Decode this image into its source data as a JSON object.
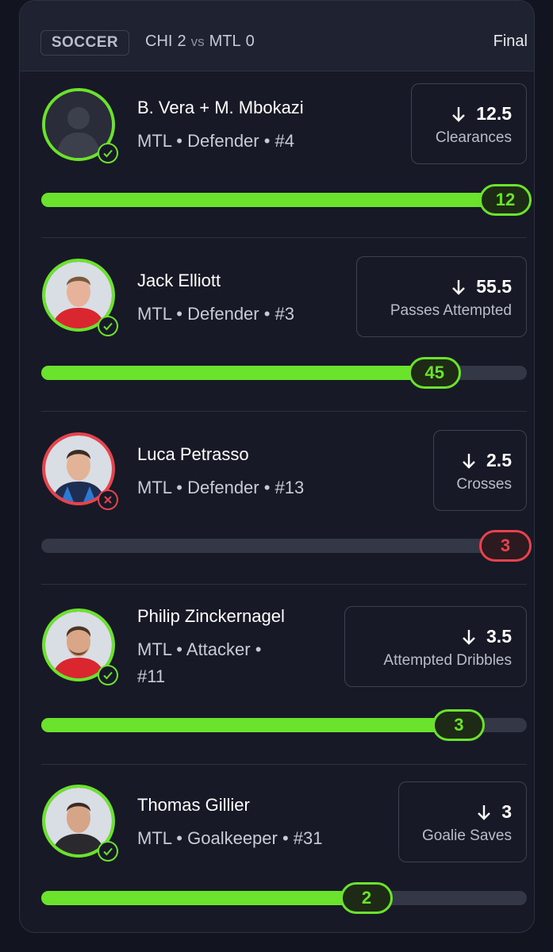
{
  "header": {
    "sport": "SOCCER",
    "team1": "CHI",
    "score1": "2",
    "vs": "vs",
    "team2": "MTL",
    "score2": "0",
    "status": "Final"
  },
  "colors": {
    "hit": "#6be22b",
    "miss": "#e8424d",
    "track": "#343746"
  },
  "players": [
    {
      "name": "B. Vera + M. Mbokazi",
      "meta_line1": "MTL • Defender • #4",
      "meta_line2": "",
      "direction_icon": "arrow-down-icon",
      "line": "12.5",
      "stat": "Clearances",
      "result": "12",
      "progress": 1.0,
      "outcome": "hit"
    },
    {
      "name": "Jack Elliott",
      "meta_line1": "MTL • Defender • #3",
      "meta_line2": "",
      "direction_icon": "arrow-down-icon",
      "line": "55.5",
      "stat": "Passes Attempted",
      "result": "45",
      "progress": 0.81,
      "outcome": "hit"
    },
    {
      "name": "Luca Petrasso",
      "meta_line1": "MTL • Defender • #13",
      "meta_line2": "",
      "direction_icon": "arrow-down-icon",
      "line": "2.5",
      "stat": "Crosses",
      "result": "3",
      "progress": 1.0,
      "outcome": "miss"
    },
    {
      "name": "Philip Zinckernagel",
      "meta_line1": "MTL • Attacker •",
      "meta_line2": "#11",
      "direction_icon": "arrow-down-icon",
      "line": "3.5",
      "stat": "Attempted Dribbles",
      "result": "3",
      "progress": 0.86,
      "outcome": "hit"
    },
    {
      "name": "Thomas Gillier",
      "meta_line1": "MTL • Goalkeeper • #31",
      "meta_line2": "",
      "direction_icon": "arrow-down-icon",
      "line": "3",
      "stat": "Goalie Saves",
      "result": "2",
      "progress": 0.67,
      "outcome": "hit"
    }
  ]
}
